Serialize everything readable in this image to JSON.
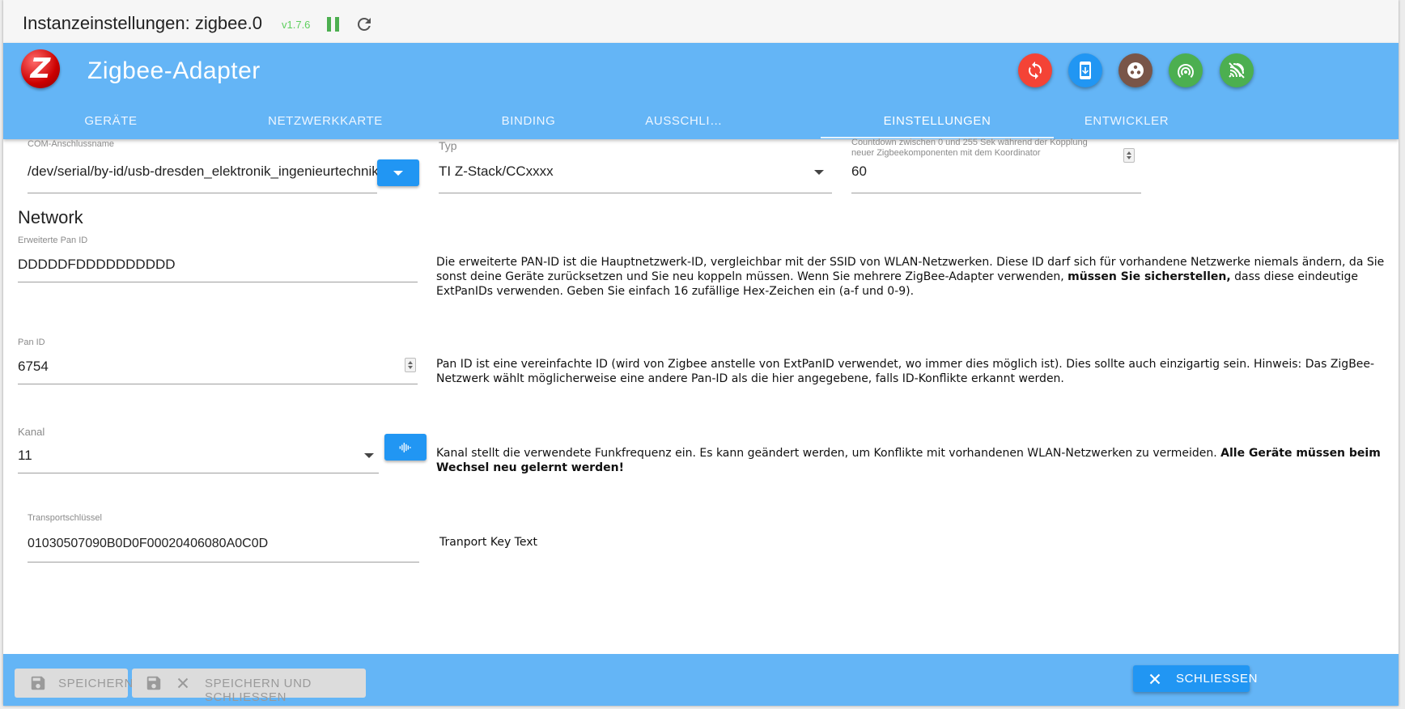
{
  "window": {
    "title": "Instanzeinstellungen: zigbee.0",
    "version": "v1.7.6"
  },
  "header": {
    "logo_letter": "Z",
    "title": "Zigbee-Adapter",
    "buttons": [
      {
        "name": "sync-button",
        "icon": "sync-icon",
        "color": "#f44336"
      },
      {
        "name": "device-update-button",
        "icon": "phone-download-icon",
        "color": "#2196f3"
      },
      {
        "name": "network-map-button",
        "icon": "dots-circle-icon",
        "color": "#795548"
      },
      {
        "name": "pairing-button",
        "icon": "wifi-signal-icon",
        "color": "#4caf50"
      },
      {
        "name": "signal-scan-button",
        "icon": "signal-waves-icon",
        "color": "#4caf50"
      }
    ]
  },
  "tabs": [
    {
      "label": "Geräte",
      "active": false
    },
    {
      "label": "Netzwerkkarte",
      "active": false
    },
    {
      "label": "Binding",
      "active": false
    },
    {
      "label": "Ausschli…",
      "active": false
    },
    {
      "label": "Einstellungen",
      "active": true
    },
    {
      "label": "Entwickler",
      "active": false
    }
  ],
  "settings": {
    "com_port": {
      "label": "COM-Anschlussname",
      "value": "/dev/serial/by-id/usb-dresden_elektronik_ingenieurtechnik_GmbH"
    },
    "type": {
      "label": "Typ",
      "value": "TI Z-Stack/CCxxxx"
    },
    "countdown": {
      "label_line1": "Countdown zwischen 0 und 255 Sek während der Kopplung",
      "label_line2": "neuer Zigbeekomponenten mit dem Koordinator",
      "value": "60"
    }
  },
  "network": {
    "section_title": "Network",
    "ext_pan_id": {
      "label": "Erweiterte Pan ID",
      "value": "DDDDDFDDDDDDDDDD",
      "help_pre": "Die erweiterte PAN-ID ist die Hauptnetzwerk-ID, vergleichbar mit der SSID von WLAN-Netzwerken. Diese ID darf sich für vorhandene Netzwerke niemals ändern, da Sie sonst deine Geräte zurücksetzen und Sie neu koppeln müssen. Wenn Sie mehrere ZigBee-Adapter verwenden, ",
      "help_bold": "müssen Sie sicherstellen,",
      "help_post": " dass diese eindeutige ExtPanIDs verwenden. Geben Sie einfach 16 zufällige Hex-Zeichen ein (a-f und 0-9)."
    },
    "pan_id": {
      "label": "Pan ID",
      "value": "6754",
      "help": "Pan ID ist eine vereinfachte ID (wird von Zigbee anstelle von ExtPanID verwendet, wo immer dies möglich ist). Dies sollte auch einzigartig sein. Hinweis: Das ZigBee-Netzwerk wählt möglicherweise eine andere Pan-ID als die hier angegebene, falls ID-Konflikte erkannt werden."
    },
    "channel": {
      "label": "Kanal",
      "value": "11",
      "help_pre": "Kanal stellt die verwendete Funkfrequenz ein. Es kann geändert werden, um Konflikte mit vorhandenen WLAN-Netzwerken zu vermeiden. ",
      "help_bold": "Alle Geräte müssen beim Wechsel neu gelernt werden!"
    },
    "transport_key": {
      "label": "Transportschlüssel",
      "value": "01030507090B0D0F00020406080A0C0D",
      "help": "Tranport Key Text"
    }
  },
  "footer": {
    "save_label": "Speichern",
    "save_close_label": "Speichern und schliessen",
    "close_label": "Schliessen"
  }
}
